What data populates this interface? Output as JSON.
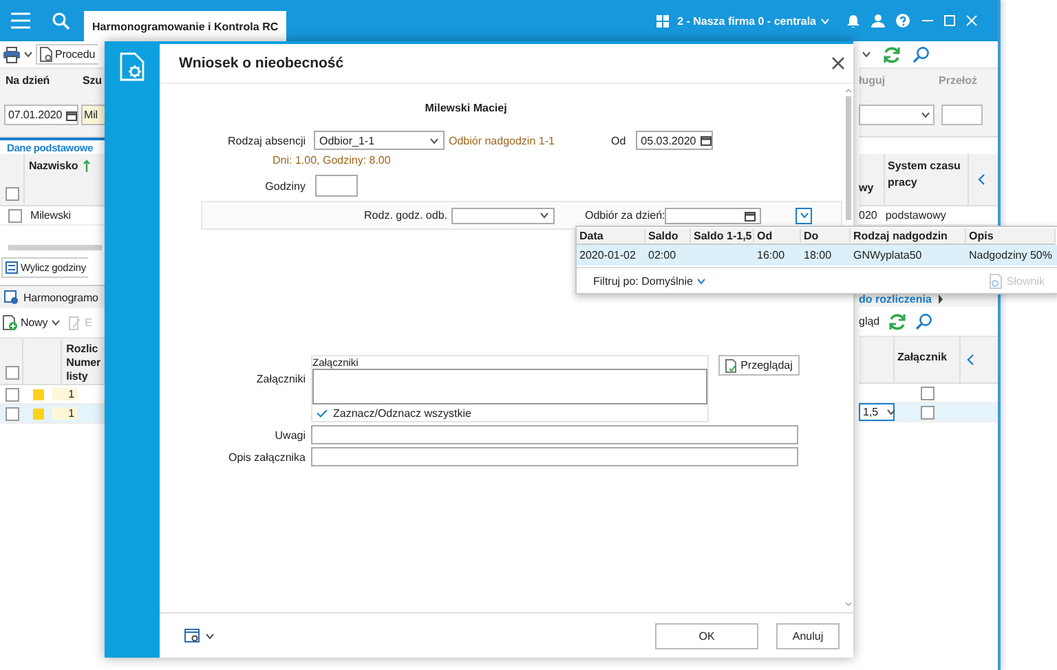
{
  "main_window": {
    "tab": "Harmonogramowanie i Kontrola RC",
    "company": "2 - Nasza firma 0 - centrala",
    "toolbar_button": "Procedu",
    "filter_labels": [
      "Na dzień",
      "Szu"
    ],
    "date": "07.01.2020",
    "search_value": "Mil",
    "right_headers": [
      "ługuj",
      "Przełoż"
    ],
    "left_tab": "Dane podstawowe",
    "right_tab": "do rozliczenia",
    "employee_columns": [
      "Nazwisko",
      "wy",
      "System czasu pracy"
    ],
    "employee_select_all": false,
    "employee_row": {
      "name": "Milewski",
      "date_part": "020",
      "work_time_system": "podstawowy",
      "checked": false
    },
    "calc_button": "Wylicz godziny",
    "section": "Harmonogramo",
    "new_button": "Nowy",
    "edit_button": "E",
    "preview_button": "gląd",
    "schedule_columns": [
      "Rozlic",
      "Numer",
      "listy",
      "Załącznik"
    ],
    "schedule_select_all": false,
    "schedule_rows": [
      {
        "checked": false,
        "color": "#ffd11a",
        "number": "1",
        "selected": false,
        "attachment_checked": false
      },
      {
        "checked": false,
        "color": "#ffd11a",
        "number": "1",
        "selected": true,
        "rate": "1,5",
        "attachment_checked": false
      }
    ]
  },
  "dialog": {
    "title": "Wniosek o nieobecność",
    "employee": "Milewski Maciej",
    "absence_type": {
      "label": "Rodzaj absencji",
      "value": "Odbior_1-1",
      "description": "Odbiór nadgodzin 1-1"
    },
    "from": {
      "label": "Od",
      "value": "05.03.2020"
    },
    "summary": "Dni: 1.00, Godziny: 8.00",
    "hours": {
      "label": "Godziny"
    },
    "overtime_type": {
      "label": "Rodz. godz. odb."
    },
    "pickup_day": {
      "label": "Odbiór za dzień:"
    },
    "attachments": {
      "label": "Załączniki",
      "list_header": "Załączniki",
      "select_all": {
        "label": "Zaznacz/Odznacz wszystkie",
        "checked": true
      },
      "browse_button": "Przeglądaj"
    },
    "notes": {
      "label": "Uwagi"
    },
    "attachment_description": {
      "label": "Opis załącznika"
    },
    "buttons": [
      "OK",
      "Anuluj"
    ]
  },
  "popup": {
    "columns": [
      "Data",
      "Saldo",
      "Saldo 1-1,5",
      "Od",
      "Do",
      "Rodzaj nadgodzin",
      "Opis"
    ],
    "rows": [
      {
        "cells": [
          "2020-01-02",
          "02:00",
          null,
          "16:00",
          "18:00",
          "GNWyplata50",
          "Nadgodziny 50%"
        ],
        "selected": true
      }
    ],
    "filter": "Filtruj po: Domyślnie",
    "dictionary_button": {
      "label": "Słownik",
      "disabled": true
    }
  }
}
